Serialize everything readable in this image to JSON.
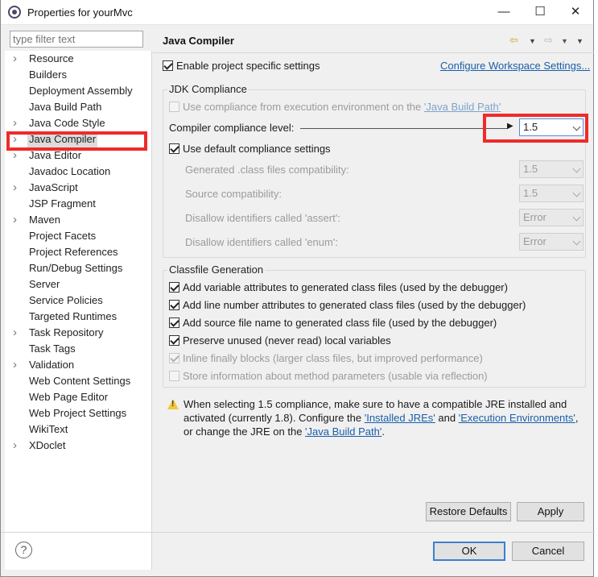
{
  "window": {
    "title": "Properties for yourMvc",
    "minimize": "—",
    "maximize": "☐",
    "close": "✕"
  },
  "filter": {
    "placeholder": "type filter text"
  },
  "tree": [
    {
      "label": "Resource",
      "expandable": true
    },
    {
      "label": "Builders",
      "expandable": false
    },
    {
      "label": "Deployment Assembly",
      "expandable": false
    },
    {
      "label": "Java Build Path",
      "expandable": false
    },
    {
      "label": "Java Code Style",
      "expandable": true
    },
    {
      "label": "Java Compiler",
      "expandable": true,
      "selected": true
    },
    {
      "label": "Java Editor",
      "expandable": true
    },
    {
      "label": "Javadoc Location",
      "expandable": false
    },
    {
      "label": "JavaScript",
      "expandable": true
    },
    {
      "label": "JSP Fragment",
      "expandable": false
    },
    {
      "label": "Maven",
      "expandable": true
    },
    {
      "label": "Project Facets",
      "expandable": false
    },
    {
      "label": "Project References",
      "expandable": false
    },
    {
      "label": "Run/Debug Settings",
      "expandable": false
    },
    {
      "label": "Server",
      "expandable": false
    },
    {
      "label": "Service Policies",
      "expandable": false
    },
    {
      "label": "Targeted Runtimes",
      "expandable": false
    },
    {
      "label": "Task Repository",
      "expandable": true
    },
    {
      "label": "Task Tags",
      "expandable": false
    },
    {
      "label": "Validation",
      "expandable": true
    },
    {
      "label": "Web Content Settings",
      "expandable": false
    },
    {
      "label": "Web Page Editor",
      "expandable": false
    },
    {
      "label": "Web Project Settings",
      "expandable": false
    },
    {
      "label": "WikiText",
      "expandable": false
    },
    {
      "label": "XDoclet",
      "expandable": true
    }
  ],
  "page": {
    "title": "Java Compiler",
    "enable_specific": "Enable project specific settings",
    "configure_workspace": "Configure Workspace Settings...",
    "jdk": {
      "group_label": "JDK Compliance",
      "use_env_prefix": "Use compliance from execution environment on the ",
      "use_env_link": "'Java Build Path'",
      "level_label": "Compiler compliance level:",
      "level_value": "1.5",
      "use_default": "Use default compliance settings",
      "rows": [
        {
          "label": "Generated .class files compatibility:",
          "value": "1.5"
        },
        {
          "label": "Source compatibility:",
          "value": "1.5"
        },
        {
          "label": "Disallow identifiers called 'assert':",
          "value": "Error"
        },
        {
          "label": "Disallow identifiers called 'enum':",
          "value": "Error"
        }
      ]
    },
    "classfile": {
      "group_label": "Classfile Generation",
      "options": [
        {
          "label": "Add variable attributes to generated class files (used by the debugger)",
          "checked": true,
          "enabled": true
        },
        {
          "label": "Add line number attributes to generated class files (used by the debugger)",
          "checked": true,
          "enabled": true
        },
        {
          "label": "Add source file name to generated class file (used by the debugger)",
          "checked": true,
          "enabled": true
        },
        {
          "label": "Preserve unused (never read) local variables",
          "checked": true,
          "enabled": true
        },
        {
          "label": "Inline finally blocks (larger class files, but improved performance)",
          "checked": true,
          "enabled": false
        },
        {
          "label": "Store information about method parameters (usable via reflection)",
          "checked": false,
          "enabled": false
        }
      ]
    },
    "warning": {
      "line1": "When selecting 1.5 compliance, make sure to have a compatible JRE installed and",
      "line2_prefix": "activated (currently 1.8). Configure the ",
      "link_jres": "'Installed JREs'",
      "and": " and ",
      "link_env": "'Execution Environments'",
      "comma": ",",
      "line3_prefix": "or change the JRE on the ",
      "link_build_path": "'Java Build Path'",
      "period": "."
    },
    "restore_defaults": "Restore Defaults",
    "apply": "Apply"
  },
  "footer": {
    "help": "?",
    "ok": "OK",
    "cancel": "Cancel"
  },
  "colors": {
    "highlight_red": "#ee2b2b",
    "link_blue": "#1a5ea8",
    "primary_border": "#3c7fd1",
    "warning_yellow": "#f2c83a"
  }
}
